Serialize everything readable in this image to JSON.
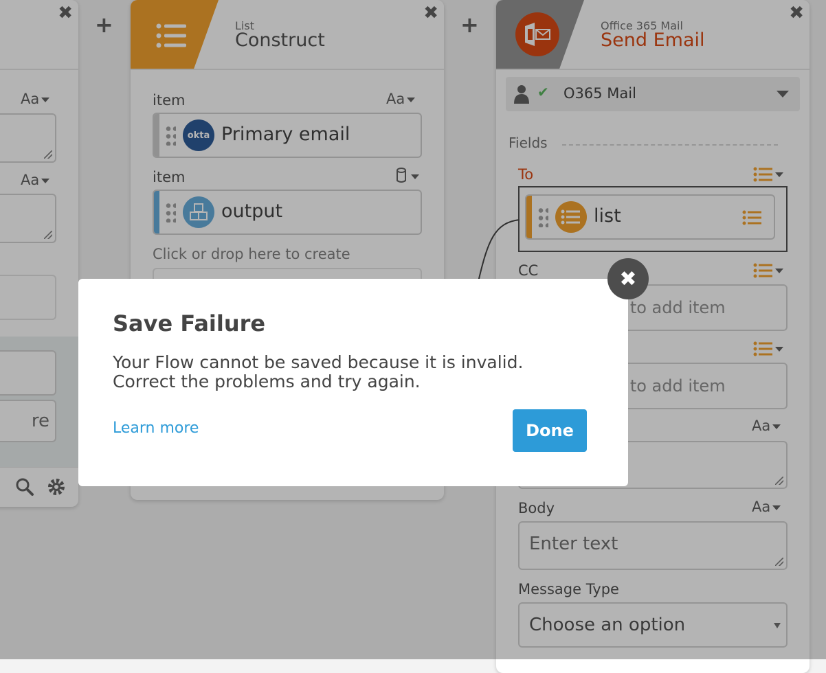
{
  "canvas": {
    "plus_icon": "+",
    "close_icon": "✖"
  },
  "left_card": {
    "aa_label": "Aa",
    "partial_text": "re"
  },
  "list_card": {
    "subtitle": "List",
    "title": "Construct",
    "accent": "#f19a1e",
    "items": [
      {
        "label": "item",
        "type": "Aa",
        "chip_text": "Primary email",
        "chip_icon": "okta",
        "chip_color": "#1d4f91"
      },
      {
        "label": "item",
        "type": "db",
        "chip_text": "output",
        "chip_icon": "cubes",
        "chip_color": "#5aa7d9"
      }
    ],
    "drop_hint": "Click or drop here to create"
  },
  "mail_card": {
    "subtitle": "Office 365 Mail",
    "title": "Send Email",
    "brand_color": "#d83b01",
    "connection": "O365 Mail",
    "fields_label": "Fields",
    "to_label": "To",
    "to_chip": "list",
    "cc_label": "CC",
    "add_item_hint": "Click to add item",
    "body_label": "Body",
    "body_placeholder": "Enter text",
    "message_type_label": "Message Type",
    "message_type_value": "Choose an option",
    "aa_label": "Aa"
  },
  "modal": {
    "title": "Save Failure",
    "message_line1": "Your Flow cannot be saved because it is invalid.",
    "message_line2": "Correct the problems and try again.",
    "learn_more": "Learn more",
    "done": "Done"
  }
}
